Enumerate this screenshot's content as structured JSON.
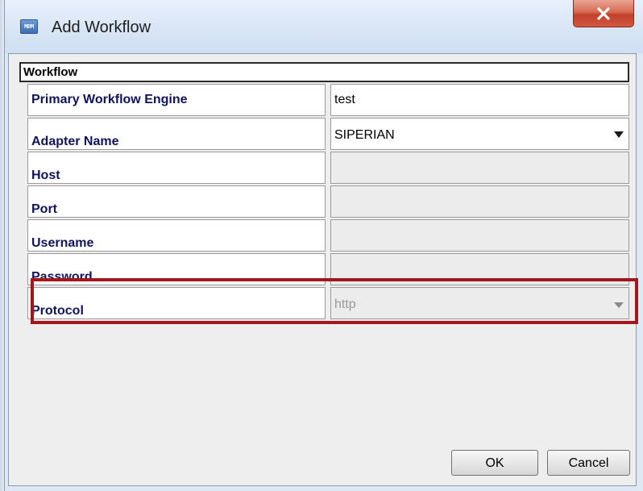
{
  "window": {
    "title": "Add Workflow",
    "app_icon_text": "MDM",
    "close_icon": "close-x-icon"
  },
  "section": {
    "title": "Workflow"
  },
  "form": {
    "primary_engine": {
      "label": "Primary Workflow Engine",
      "value": "test"
    },
    "adapter_name": {
      "label": "Adapter Name",
      "value": "SIPERIAN",
      "icon": "chevron-down-icon"
    },
    "host": {
      "label": "Host",
      "value": ""
    },
    "port": {
      "label": "Port",
      "value": ""
    },
    "username": {
      "label": "Username",
      "value": ""
    },
    "password": {
      "label": "Password",
      "value": ""
    },
    "protocol": {
      "label": "Protocol",
      "value": "http",
      "icon": "chevron-down-icon"
    }
  },
  "buttons": {
    "ok": "OK",
    "cancel": "Cancel"
  },
  "colors": {
    "highlight": "#a0181d",
    "label_text": "#10145e",
    "close_button": "#c2412a"
  }
}
